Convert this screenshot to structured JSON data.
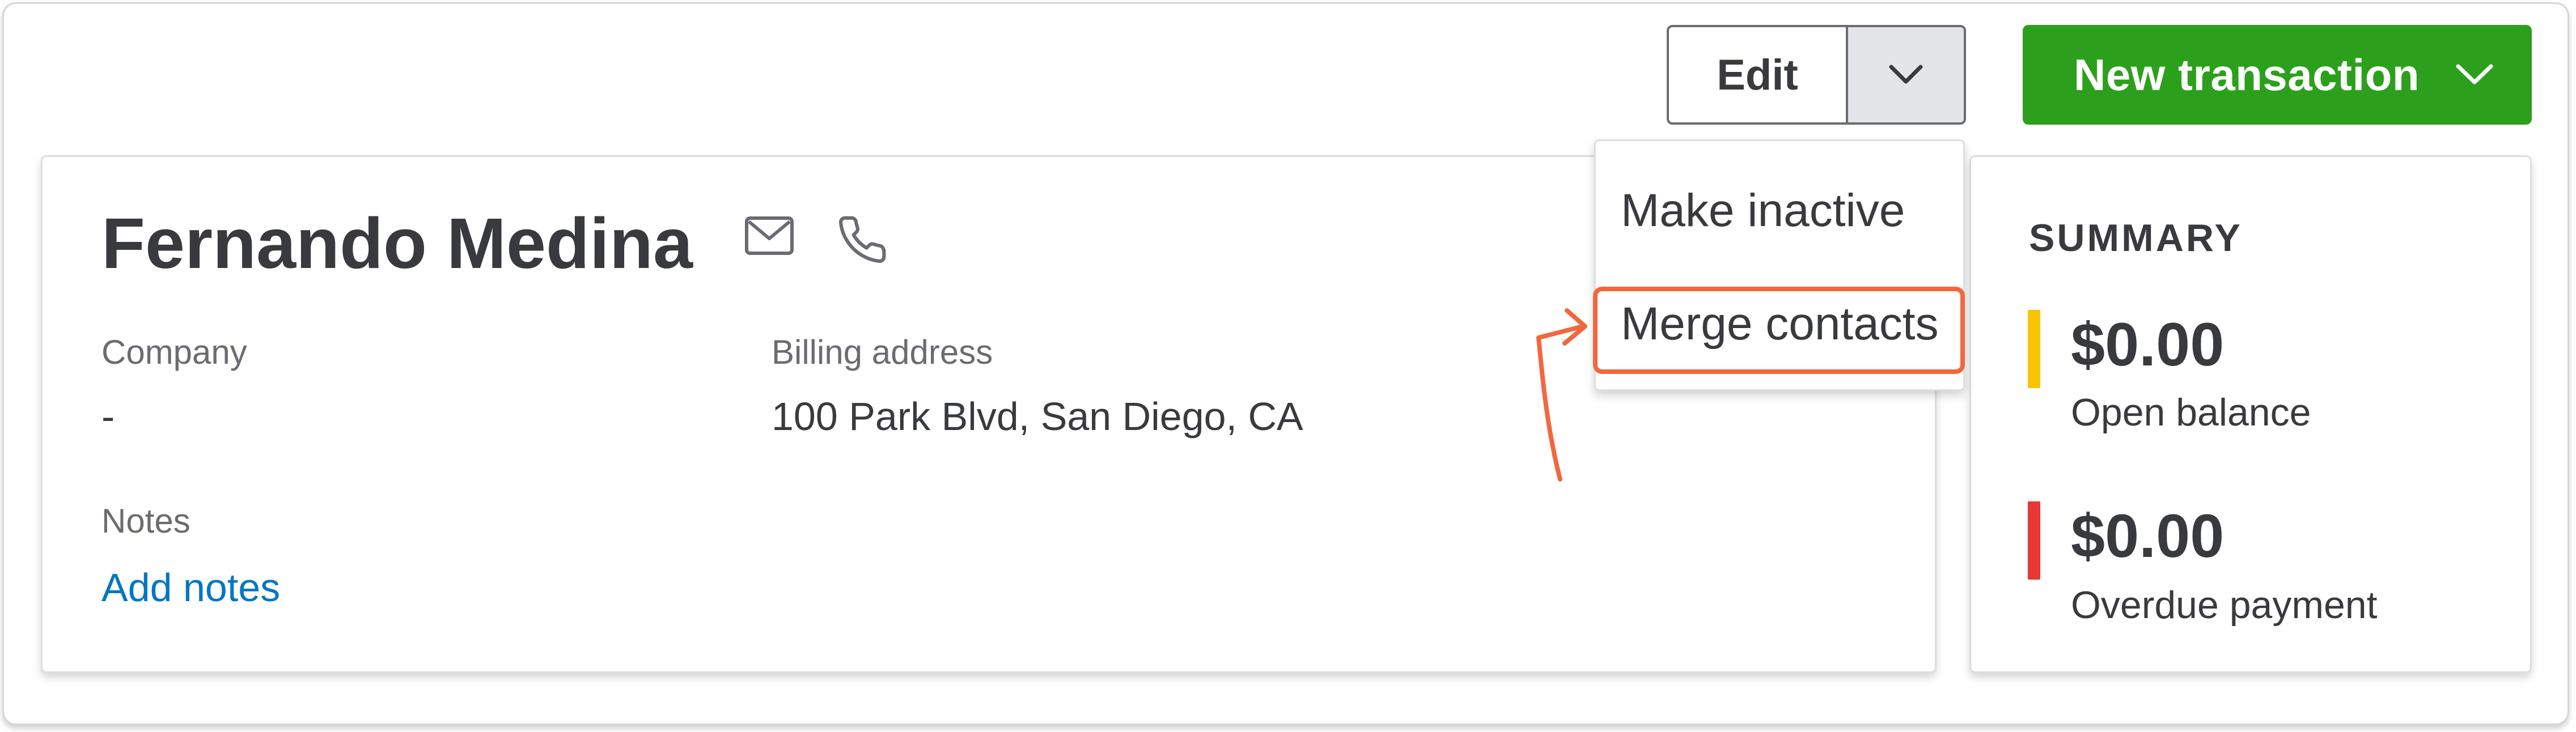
{
  "toolbar": {
    "edit_label": "Edit",
    "new_transaction_label": "New transaction"
  },
  "customer": {
    "name": "Fernando Medina",
    "company_label": "Company",
    "company_value": "-",
    "billing_label": "Billing address",
    "billing_value": "100 Park Blvd, San Diego, CA",
    "notes_label": "Notes",
    "add_notes_link": "Add notes"
  },
  "edit_menu": {
    "items": [
      {
        "label": "Make inactive"
      },
      {
        "label": "Merge contacts"
      }
    ],
    "highlighted_index": 1
  },
  "summary": {
    "title": "SUMMARY",
    "items": [
      {
        "amount": "$0.00",
        "label": "Open balance",
        "color": "#f7c500"
      },
      {
        "amount": "$0.00",
        "label": "Overdue payment",
        "color": "#e53935"
      }
    ]
  },
  "colors": {
    "primary_green": "#2ca01c",
    "link_blue": "#0077c5",
    "annotation_orange": "#f2683e",
    "text_dark": "#393a3d"
  },
  "icons": [
    "email-icon",
    "phone-icon",
    "chevron-down-icon"
  ]
}
